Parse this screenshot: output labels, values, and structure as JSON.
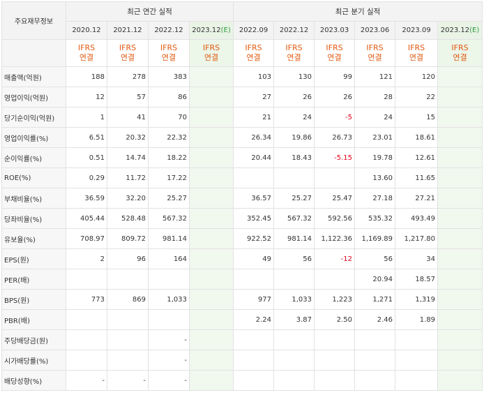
{
  "header": {
    "row_label_title": "주요재무정보",
    "annual_group": "최근 연간 실적",
    "quarter_group": "최근 분기 실적",
    "annual_periods": [
      {
        "label": "2020.12",
        "est": ""
      },
      {
        "label": "2021.12",
        "est": ""
      },
      {
        "label": "2022.12",
        "est": ""
      },
      {
        "label": "2023.12",
        "est": "(E)"
      }
    ],
    "quarter_periods": [
      {
        "label": "2022.09",
        "est": ""
      },
      {
        "label": "2022.12",
        "est": ""
      },
      {
        "label": "2023.03",
        "est": ""
      },
      {
        "label": "2023.06",
        "est": ""
      },
      {
        "label": "2023.09",
        "est": ""
      },
      {
        "label": "2023.12",
        "est": "(E)"
      }
    ],
    "accounting_line1": "IFRS",
    "accounting_line2": "연결"
  },
  "colors": {
    "accent_orange": "#e05a12",
    "negative_red": "#e2001a",
    "estimate_green": "#2e9a3b"
  },
  "rows": [
    {
      "label": "매출액(억원)",
      "sep": true,
      "values": [
        "188",
        "278",
        "383",
        "",
        "103",
        "130",
        "99",
        "121",
        "120",
        ""
      ]
    },
    {
      "label": "영업이익(억원)",
      "sep": false,
      "values": [
        "12",
        "57",
        "86",
        "",
        "27",
        "26",
        "26",
        "28",
        "22",
        ""
      ]
    },
    {
      "label": "당기순이익(억원)",
      "sep": false,
      "values": [
        "1",
        "41",
        "70",
        "",
        "21",
        "24",
        "-5",
        "24",
        "15",
        ""
      ]
    },
    {
      "label": "영업이익률(%)",
      "sep": true,
      "values": [
        "6.51",
        "20.32",
        "22.32",
        "",
        "26.34",
        "19.86",
        "26.73",
        "23.01",
        "18.61",
        ""
      ]
    },
    {
      "label": "순이익률(%)",
      "sep": false,
      "values": [
        "0.51",
        "14.74",
        "18.22",
        "",
        "20.44",
        "18.43",
        "-5.15",
        "19.78",
        "12.61",
        ""
      ]
    },
    {
      "label": "ROE(%)",
      "sep": false,
      "values": [
        "0.29",
        "11.72",
        "17.22",
        "",
        "",
        "",
        "",
        "13.60",
        "11.65",
        ""
      ]
    },
    {
      "label": "부채비율(%)",
      "sep": true,
      "values": [
        "36.59",
        "32.20",
        "25.27",
        "",
        "36.57",
        "25.27",
        "25.47",
        "27.18",
        "27.21",
        ""
      ]
    },
    {
      "label": "당좌비율(%)",
      "sep": false,
      "values": [
        "405.44",
        "528.48",
        "567.32",
        "",
        "352.45",
        "567.32",
        "592.56",
        "535.32",
        "493.49",
        ""
      ]
    },
    {
      "label": "유보율(%)",
      "sep": false,
      "values": [
        "708.97",
        "809.72",
        "981.14",
        "",
        "922.52",
        "981.14",
        "1,122.36",
        "1,169.89",
        "1,217.80",
        ""
      ]
    },
    {
      "label": "EPS(원)",
      "sep": true,
      "values": [
        "2",
        "96",
        "164",
        "",
        "49",
        "56",
        "-12",
        "56",
        "34",
        ""
      ]
    },
    {
      "label": "PER(배)",
      "sep": false,
      "values": [
        "",
        "",
        "",
        "",
        "",
        "",
        "",
        "20.94",
        "18.57",
        ""
      ]
    },
    {
      "label": "BPS(원)",
      "sep": false,
      "values": [
        "773",
        "869",
        "1,033",
        "",
        "977",
        "1,033",
        "1,223",
        "1,271",
        "1,319",
        ""
      ]
    },
    {
      "label": "PBR(배)",
      "sep": false,
      "values": [
        "",
        "",
        "",
        "",
        "2.24",
        "3.87",
        "2.50",
        "2.46",
        "1.89",
        ""
      ]
    },
    {
      "label": "주당배당금(원)",
      "sep": true,
      "values": [
        "",
        "",
        "-",
        "",
        "",
        "",
        "",
        "",
        "",
        ""
      ]
    },
    {
      "label": "시가배당률(%)",
      "sep": false,
      "values": [
        "",
        "",
        "-",
        "",
        "",
        "",
        "",
        "",
        "",
        ""
      ]
    },
    {
      "label": "배당성향(%)",
      "sep": false,
      "values": [
        "-",
        "-",
        "-",
        "",
        "",
        "",
        "",
        "",
        "",
        ""
      ]
    }
  ]
}
